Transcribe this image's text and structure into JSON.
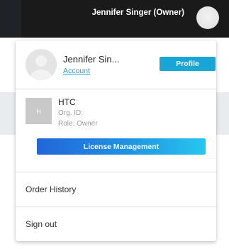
{
  "header": {
    "user_label": "Jennifer Singer (Owner)"
  },
  "dropdown": {
    "user": {
      "name": "Jennifer Sin...",
      "account_link": "Account",
      "profile_button": "Profile"
    },
    "organization": {
      "logo_text": "H",
      "name": "HTC",
      "org_id_label": "Org. ID:",
      "role_label": "Role: Owner",
      "license_button": "License Management"
    },
    "menu_items": [
      {
        "label": "Order History"
      },
      {
        "label": "Sign out"
      }
    ]
  },
  "colors": {
    "topbar": "#1a1a1a",
    "accent": "#18a6d6",
    "link": "#2aa0d6",
    "gradient_start": "#2266d9",
    "gradient_end": "#27c6ef"
  },
  "icons": {
    "header_avatar": "avatar-icon",
    "user_avatar": "user-silhouette-icon"
  }
}
